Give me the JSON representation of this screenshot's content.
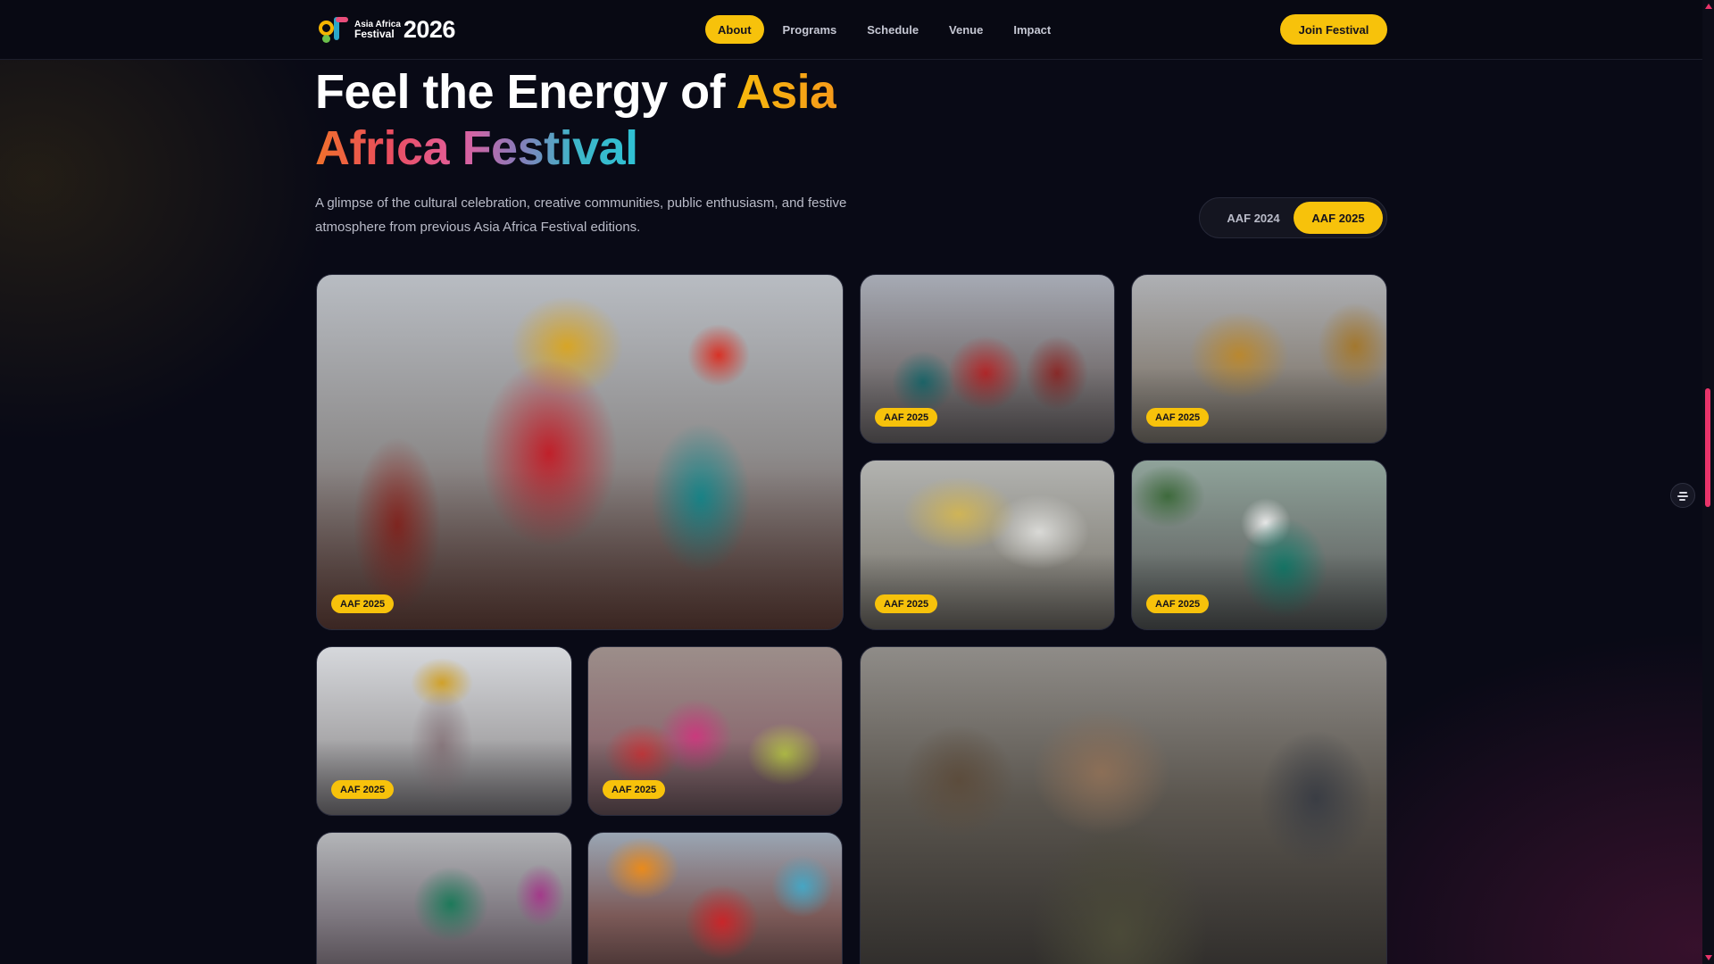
{
  "nav": {
    "logo": {
      "line1": "Asia Africa",
      "line2": "Festival",
      "year": "2026"
    },
    "links": [
      {
        "label": "About",
        "active": true
      },
      {
        "label": "Programs",
        "active": false
      },
      {
        "label": "Schedule",
        "active": false
      },
      {
        "label": "Venue",
        "active": false
      },
      {
        "label": "Impact",
        "active": false
      }
    ],
    "cta": "Join Festival"
  },
  "hero": {
    "title_part1": "Feel the Energy of ",
    "title_part2": "Asia",
    "title_part3": "Africa Festival",
    "description": "A glimpse of the cultural celebration, creative communities, public enthusiasm, and festive atmosphere from previous Asia Africa Festival editions."
  },
  "edition_toggle": {
    "options": [
      "AAF 2024",
      "AAF 2025"
    ],
    "selected": "AAF 2025"
  },
  "gallery": [
    {
      "badge": "AAF 2025"
    },
    {
      "badge": "AAF 2025"
    },
    {
      "badge": "AAF 2025"
    },
    {
      "badge": "AAF 2025"
    },
    {
      "badge": "AAF 2025"
    },
    {
      "badge": "AAF 2025"
    },
    {
      "badge": "AAF 2025"
    },
    {
      "badge": ""
    },
    {
      "badge": ""
    },
    {
      "badge": ""
    }
  ],
  "colors": {
    "background": "#090a16",
    "accent": "#f7c20b",
    "scroll_accent": "#e8346a"
  }
}
